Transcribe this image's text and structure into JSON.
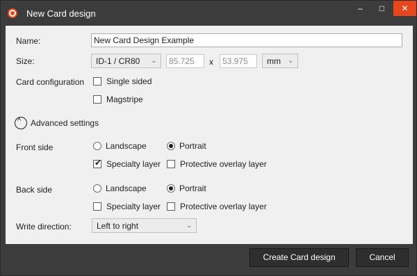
{
  "window": {
    "title": "New Card design",
    "minimize_glyph": "–",
    "maximize_glyph": "□",
    "close_glyph": "✕"
  },
  "form": {
    "name_label": "Name:",
    "name_value": "New Card Design Example",
    "size_label": "Size:",
    "size_select": "ID-1 / CR80",
    "width_value": "85.725",
    "times_label": "x",
    "height_value": "53.975",
    "unit_select": "mm",
    "card_config_label": "Card configuration",
    "single_sided_label": "Single sided",
    "single_sided_checked": false,
    "magstripe_label": "Magstripe",
    "magstripe_checked": false,
    "advanced_label": "Advanced settings",
    "front_side": {
      "label": "Front side",
      "landscape_label": "Landscape",
      "portrait_label": "Portrait",
      "orientation": "Portrait",
      "specialty_label": "Specialty layer",
      "specialty_checked": true,
      "protective_label": "Protective overlay layer",
      "protective_checked": false
    },
    "back_side": {
      "label": "Back side",
      "landscape_label": "Landscape",
      "portrait_label": "Portrait",
      "orientation": "Portrait",
      "specialty_label": "Specialty layer",
      "specialty_checked": false,
      "protective_label": "Protective overlay layer",
      "protective_checked": false
    },
    "write_direction_label": "Write direction:",
    "write_direction_value": "Left to right"
  },
  "footer": {
    "create_label": "Create Card design",
    "cancel_label": "Cancel"
  },
  "colors": {
    "close_button": "#e8461d",
    "titlebar": "#3c3c3c",
    "panel": "#f0f0f0"
  }
}
